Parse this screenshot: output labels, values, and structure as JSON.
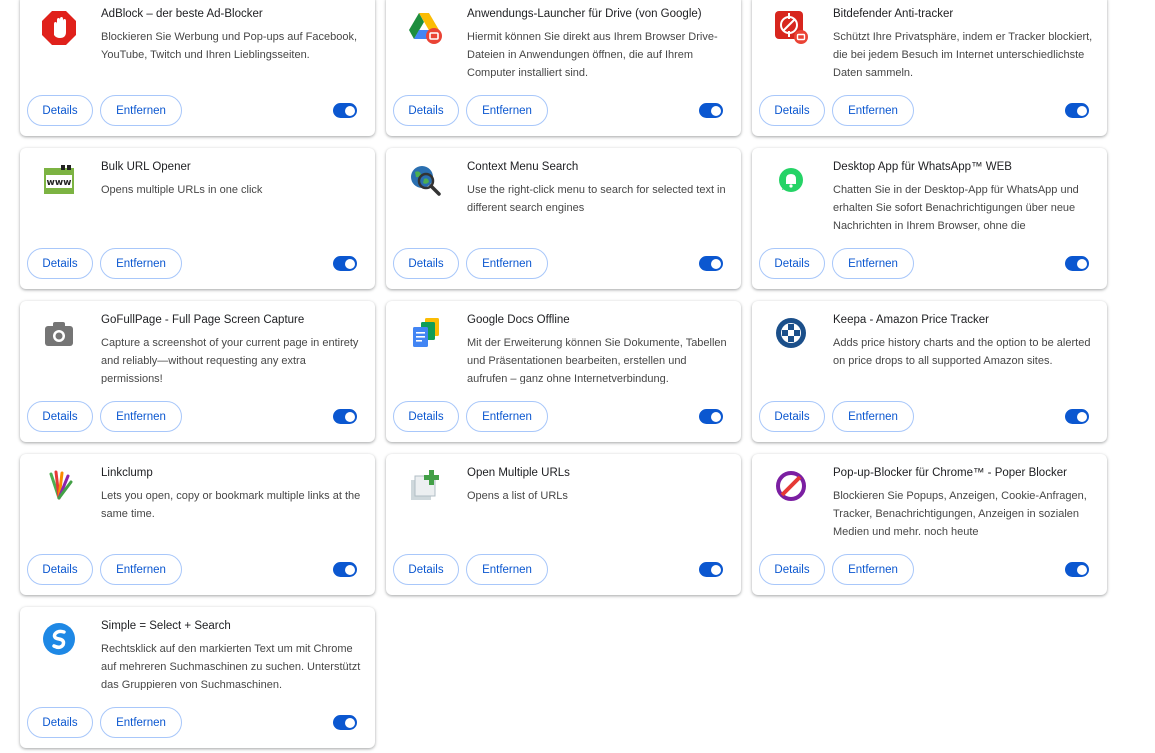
{
  "buttons": {
    "details": "Details",
    "remove": "Entfernen"
  },
  "extensions": [
    {
      "title": "AdBlock – der beste Ad-Blocker",
      "description": "Blockieren Sie Werbung und Pop-ups auf Facebook, YouTube, Twitch und Ihren Lieblingsseiten.",
      "icon": "adblock-icon",
      "enabled": true
    },
    {
      "title": "Anwendungs-Launcher für Drive (von Google)",
      "description": "Hiermit können Sie direkt aus Ihrem Browser Drive-Dateien in Anwendungen öffnen, die auf Ihrem Computer installiert sind.",
      "icon": "google-drive-icon",
      "enabled": true
    },
    {
      "title": "Bitdefender Anti-tracker",
      "description": "Schützt Ihre Privatsphäre, indem er Tracker blockiert, die bei jedem Besuch im Internet unterschiedlichste Daten sammeln.",
      "icon": "bitdefender-icon",
      "enabled": true
    },
    {
      "title": "Bulk URL Opener",
      "description": "Opens multiple URLs in one click",
      "icon": "www-icon",
      "enabled": true
    },
    {
      "title": "Context Menu Search",
      "description": "Use the right-click menu to search for selected text in different search engines",
      "icon": "globe-search-icon",
      "enabled": true
    },
    {
      "title": "Desktop App für WhatsApp™ WEB",
      "description": "Chatten Sie in der Desktop-App für WhatsApp und erhalten Sie sofort Benachrichtigungen über neue Nachrichten in Ihrem Browser, ohne die",
      "icon": "whatsapp-bell-icon",
      "enabled": true
    },
    {
      "title": "GoFullPage - Full Page Screen Capture",
      "description": "Capture a screenshot of your current page in entirety and reliably—without requesting any extra permissions!",
      "icon": "camera-icon",
      "enabled": true
    },
    {
      "title": "Google Docs Offline",
      "description": "Mit der Erweiterung können Sie Dokumente, Tabellen und Präsentationen bearbeiten, erstellen und aufrufen – ganz ohne Internetverbindung.",
      "icon": "google-docs-icon",
      "enabled": true
    },
    {
      "title": "Keepa - Amazon Price Tracker",
      "description": "Adds price history charts and the option to be alerted on price drops to all supported Amazon sites.",
      "icon": "keepa-icon",
      "enabled": true
    },
    {
      "title": "Linkclump",
      "description": "Lets you open, copy or bookmark multiple links at the same time.",
      "icon": "linkclump-icon",
      "enabled": true
    },
    {
      "title": "Open Multiple URLs",
      "description": "Opens a list of URLs",
      "icon": "open-multiple-icon",
      "enabled": true
    },
    {
      "title": "Pop-up-Blocker für Chrome™ - Poper Blocker",
      "description": "Blockieren Sie Popups, Anzeigen, Cookie-Anfragen, Tracker, Benachrichtigungen, Anzeigen in sozialen Medien und mehr. noch heute",
      "icon": "poper-blocker-icon",
      "enabled": true
    },
    {
      "title": "Simple = Select + Search",
      "description": "Rechtsklick auf den markierten Text um mit Chrome auf mehreren Suchmaschinen zu suchen. Unterstützt das Gruppieren von Suchmaschinen.",
      "icon": "simple-search-icon",
      "enabled": true
    }
  ],
  "colors": {
    "accent": "#0b57d0",
    "button_border": "#a8c7fa"
  }
}
